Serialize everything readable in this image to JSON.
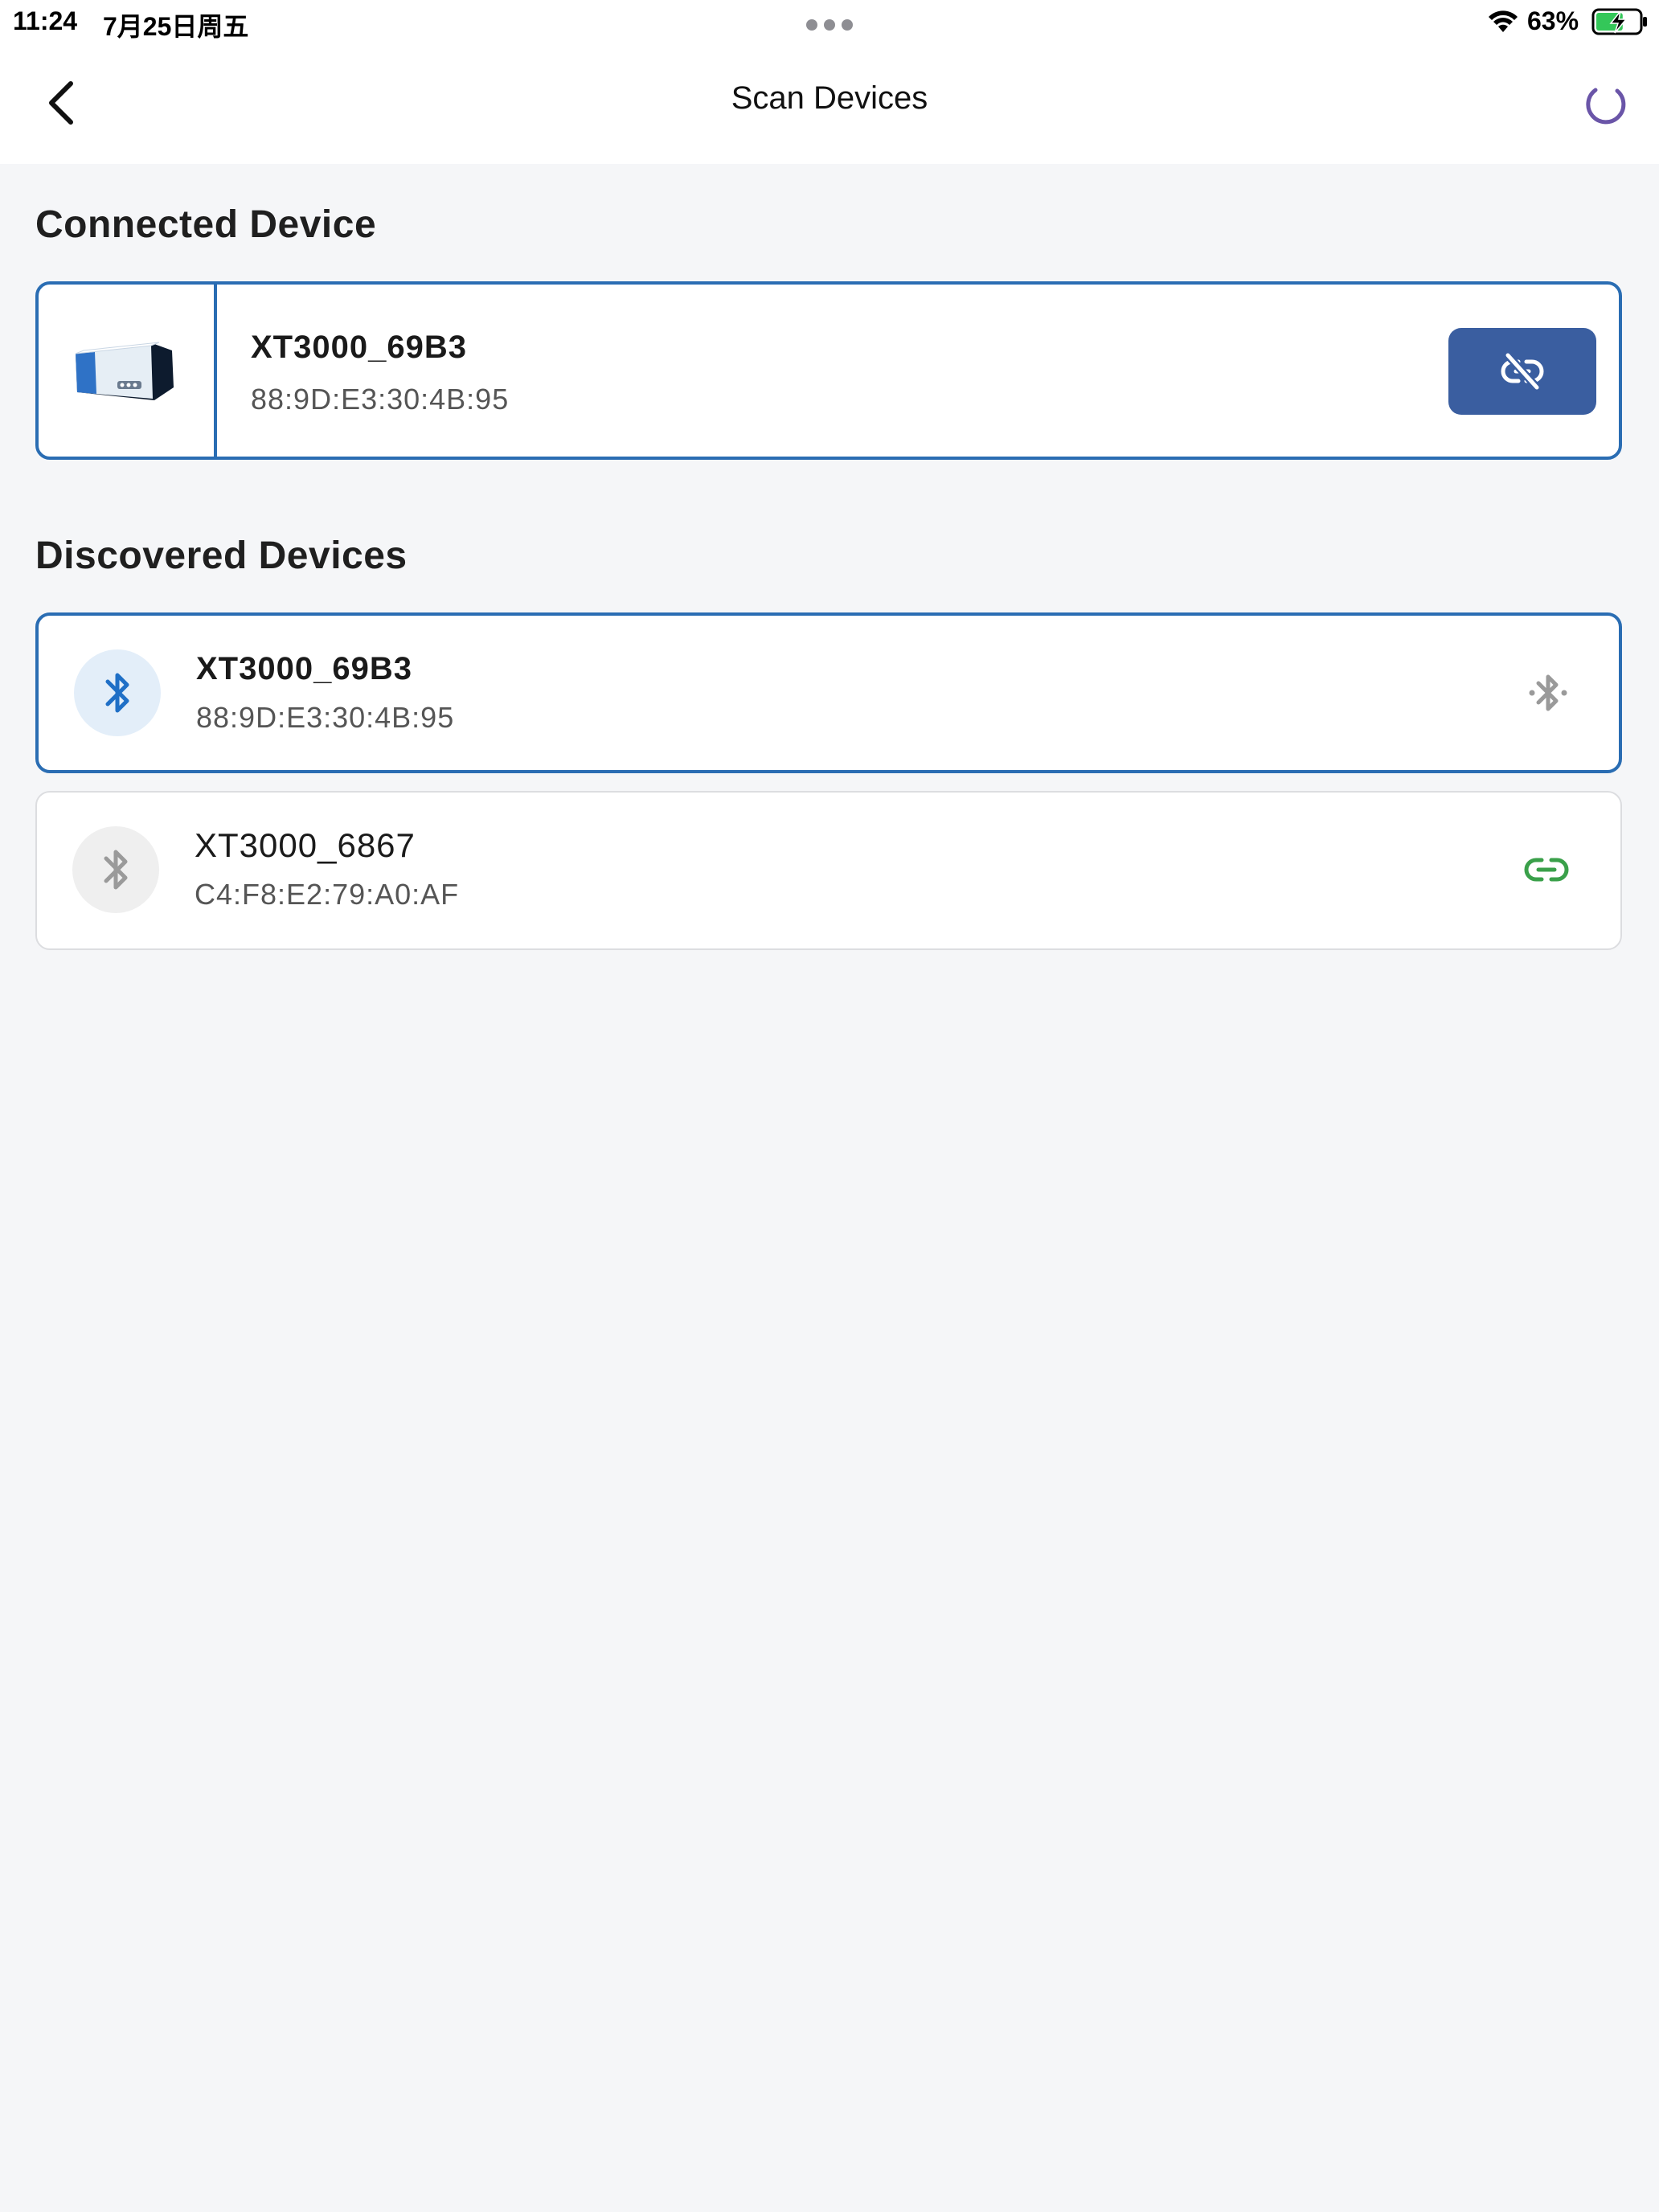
{
  "status_bar": {
    "time": "11:24",
    "date": "7月25日周五",
    "battery_percent": "63%",
    "battery_level": 0.63,
    "icons": [
      "multitask-dots-icon",
      "wifi-icon",
      "battery-charging-icon"
    ]
  },
  "nav": {
    "title": "Scan Devices",
    "back_icon": "chevron-left-icon",
    "refresh_icon": "loading-spinner-icon"
  },
  "connected_section": {
    "title": "Connected Device",
    "device": {
      "name": "XT3000_69B3",
      "mac": "88:9D:E3:30:4B:95",
      "image_icon": "printer-device-image",
      "action_icon": "unlink-icon"
    }
  },
  "discovered_section": {
    "title": "Discovered Devices",
    "devices": [
      {
        "name": "XT3000_69B3",
        "mac": "88:9D:E3:30:4B:95",
        "icon": "bluetooth-icon",
        "action_icon": "bluetooth-connected-icon",
        "state": "connected"
      },
      {
        "name": "XT3000_6867",
        "mac": "C4:F8:E2:79:A0:AF",
        "icon": "bluetooth-icon",
        "action_icon": "link-icon",
        "state": "available"
      }
    ]
  },
  "colors": {
    "background": "#f5f6f8",
    "accent_blue": "#2a6db3",
    "button_blue": "#3a5ea0",
    "spinner_purple": "#6a55a8",
    "link_green": "#3aa04a",
    "inactive_gray": "#9a9a9a"
  }
}
